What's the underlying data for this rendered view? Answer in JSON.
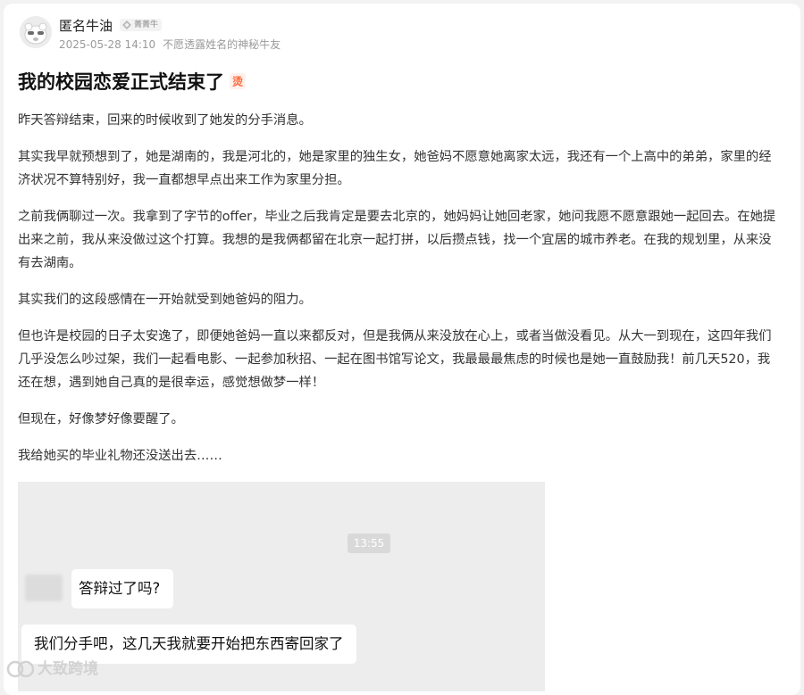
{
  "post": {
    "author": {
      "name": "匿名牛油",
      "level_badge": "菁菁牛",
      "timestamp": "2025-05-28 14:10",
      "signature": "不愿透露姓名的神秘牛友"
    },
    "title": "我的校园恋爱正式结束了",
    "title_badge": "烫",
    "paragraphs": [
      "昨天答辩结束，回来的时候收到了她发的分手消息。",
      "其实我早就预想到了，她是湖南的，我是河北的，她是家里的独生女，她爸妈不愿意她离家太远，我还有一个上高中的弟弟，家里的经济状况不算特别好，我一直都想早点出来工作为家里分担。",
      "之前我俩聊过一次。我拿到了字节的offer，毕业之后我肯定是要去北京的，她妈妈让她回老家，她问我愿不愿意跟她一起回去。在她提出来之前，我从来没做过这个打算。我想的是我俩都留在北京一起打拼，以后攒点钱，找一个宜居的城市养老。在我的规划里，从来没有去湖南。",
      "其实我们的这段感情在一开始就受到她爸妈的阻力。",
      "但也许是校园的日子太安逸了，即便她爸妈一直以来都反对，但是我俩从来没放在心上，或者当做没看见。从大一到现在，这四年我们几乎没怎么吵过架，我们一起看电影、一起参加秋招、一起在图书馆写论文，我最最最焦虑的时候也是她一直鼓励我！前几天520，我还在想，遇到她自己真的是很幸运，感觉想做梦一样！",
      "但现在，好像梦好像要醒了。",
      "我给她买的毕业礼物还没送出去……"
    ]
  },
  "chat_screenshot": {
    "time": "13:55",
    "messages": [
      {
        "text": "答辩过了吗?"
      },
      {
        "text": "我们分手吧，这几天我就要开始把东西寄回家了"
      }
    ]
  },
  "watermark": {
    "text": "大致跨境"
  },
  "icons": {
    "avatar": "cartoon-avatar-icon",
    "level": "level-badge-icon",
    "hot": "hot-badge-icon",
    "watermark": "watermark-logo-icon"
  },
  "colors": {
    "hot_badge": "#ff6a3d",
    "chat_bg": "#ededed",
    "time_badge_bg": "#d9d9d9"
  }
}
